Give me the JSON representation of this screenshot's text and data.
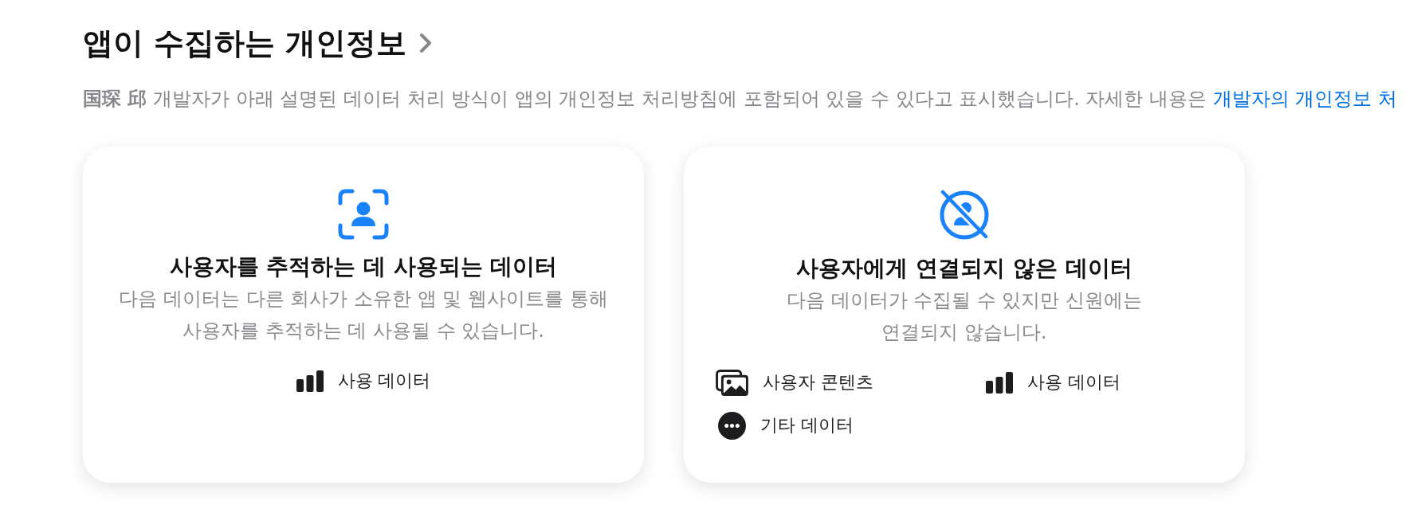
{
  "header": {
    "title": "앱이 수집하는 개인정보"
  },
  "notice": {
    "text": "**国琛 邱** 개발자가 아래 설명된 데이터 처리 방식이 앱의 개인정보 처리방침에 포함되어 있을 수 있다고 표시했습니다. 자세한 내용은",
    "link": "개발자의 개인정보 처"
  },
  "cards": [
    {
      "kind": "tracking",
      "title": "사용자를 추적하는 데 사용되는 데이터",
      "description": "다음 데이터는 다른 회사가 소유한 앱 및 웹사이트를 통해\n사용자를 추적하는 데 사용될 수 있습니다.",
      "items": [
        {
          "kind": "usage",
          "label": "사용 데이터"
        }
      ]
    },
    {
      "kind": "not-linked",
      "title": "사용자에게 연결되지 않은 데이터",
      "description": "다음 데이터가 수집될 수 있지만 신원에는\n연결되지 않습니다.",
      "items": [
        {
          "kind": "content",
          "label": "사용자 콘텐츠"
        },
        {
          "kind": "usage",
          "label": "사용 데이터"
        },
        {
          "kind": "other",
          "label": "기타 데이터"
        }
      ]
    }
  ]
}
